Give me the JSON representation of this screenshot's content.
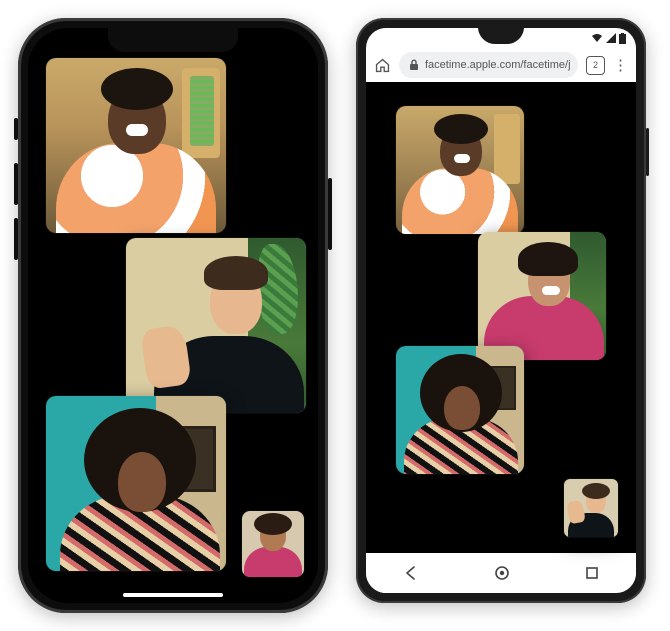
{
  "iphone": {
    "participants": [
      {
        "name": "participant-1"
      },
      {
        "name": "participant-2"
      },
      {
        "name": "participant-3"
      }
    ],
    "self_view": {
      "name": "self-view"
    }
  },
  "android": {
    "statusbar": {
      "wifi": "wifi-icon",
      "signal": "signal-icon",
      "battery": "battery-icon"
    },
    "browser": {
      "url": "facetime.apple.com/facetime/j",
      "tab_count": "2",
      "more_label": "⋮"
    },
    "participants": [
      {
        "name": "participant-1"
      },
      {
        "name": "participant-2"
      },
      {
        "name": "participant-3"
      }
    ],
    "self_view": {
      "name": "self-view"
    },
    "nav": {
      "back": "back",
      "home": "home",
      "recents": "recents"
    }
  }
}
